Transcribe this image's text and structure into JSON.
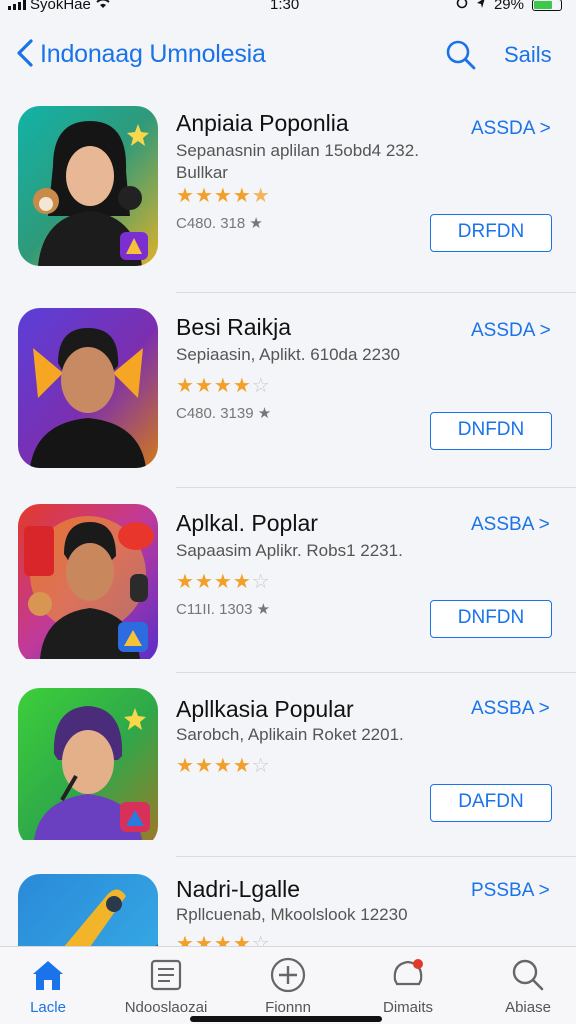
{
  "status_bar": {
    "carrier": "SyokHae",
    "time": "1:30",
    "battery_pct": "29%"
  },
  "nav": {
    "title": "Indonaag Umnolesia",
    "right_label": "Sails"
  },
  "apps": [
    {
      "name": "Anpiaia Poponlia",
      "subtitle": "Sepanasnin aplilan 15obd4 232. Bullkar",
      "rating_text": "C480. 318 ★",
      "link": "ASSDA >",
      "button": "DRFDN"
    },
    {
      "name": "Besi Raikja",
      "subtitle": "Sepiaasin, Aplikt. 610da 2230",
      "rating_text": "C480. 3139 ★",
      "link": "ASSDA >",
      "button": "DNFDN"
    },
    {
      "name": "Aplkal. Poplar",
      "subtitle": "Sapaasim Aplikr. Robs1 2231.",
      "rating_text": "C11II. 1303 ★",
      "link": "ASSBA >",
      "button": "DNFDN"
    },
    {
      "name": "Apllkasia Popular",
      "subtitle": "Sarobch, Aplikain Roket 2201.",
      "rating_text": "",
      "link": "ASSBA >",
      "button": "DAFDN"
    },
    {
      "name": "Nadri-Lgalle",
      "subtitle": "Rpllcuenab, Mkoolslook 12230",
      "rating_text": "",
      "link": "PSSBA >",
      "button": ""
    }
  ],
  "ratings": [
    4.5,
    4,
    4,
    4,
    4
  ],
  "tabs": [
    {
      "label": "Lacle",
      "icon": "home-icon"
    },
    {
      "label": "Ndooslaozai",
      "icon": "news-icon"
    },
    {
      "label": "Fionnn",
      "icon": "plus-circle-icon"
    },
    {
      "label": "Dimaits",
      "icon": "notification-icon"
    },
    {
      "label": "Abiase",
      "icon": "search-icon"
    }
  ],
  "colors": {
    "accent": "#1a73e8",
    "star": "#f2a02a"
  }
}
